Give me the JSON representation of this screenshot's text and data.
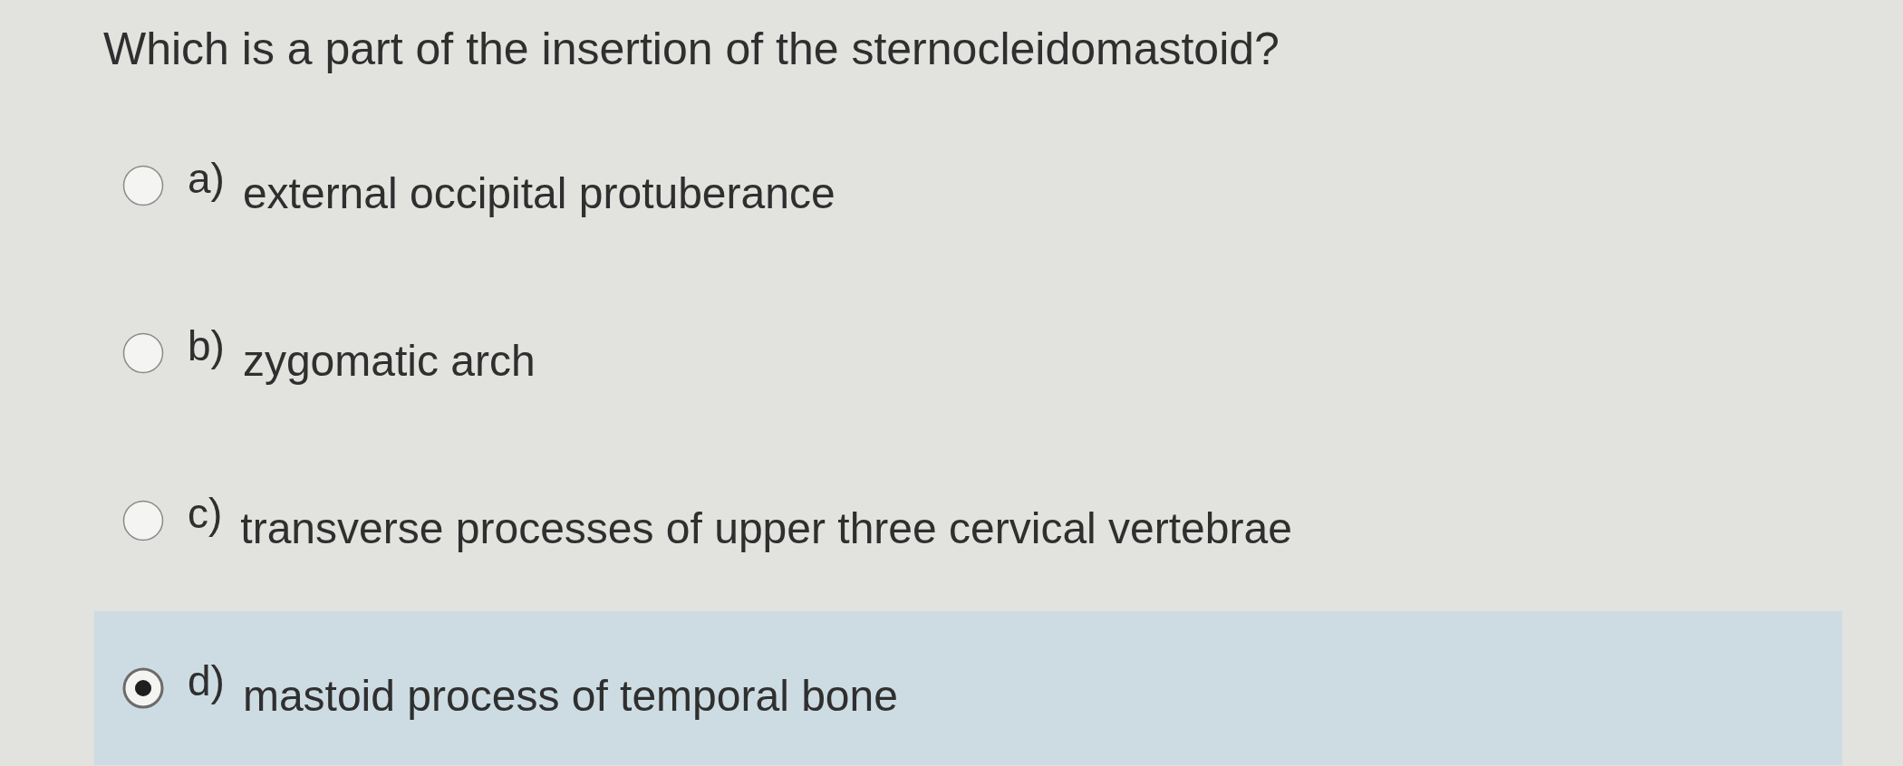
{
  "question": "Which is a part of the insertion of the sternocleidomastoid?",
  "options": [
    {
      "letter": "a)",
      "text": "external occipital protuberance",
      "selected": false
    },
    {
      "letter": "b)",
      "text": "zygomatic arch",
      "selected": false
    },
    {
      "letter": "c)",
      "text": "transverse processes of upper three cervical vertebrae",
      "selected": false
    },
    {
      "letter": "d)",
      "text": "mastoid process of temporal bone",
      "selected": true
    }
  ]
}
